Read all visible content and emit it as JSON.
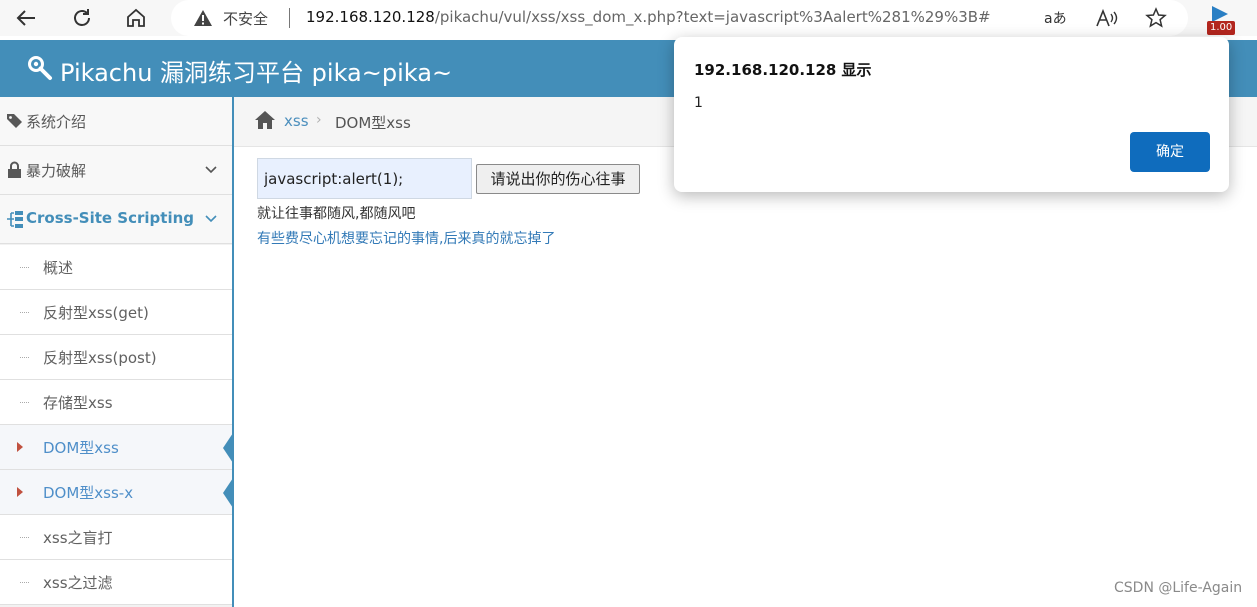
{
  "browser": {
    "security_label": "不安全",
    "url_host": "192.168.120.128",
    "url_path": "/pikachu/vul/xss/xss_dom_x.php?text=javascript%3Aalert%281%29%3B#",
    "extension_badge": "1.00"
  },
  "header": {
    "title": "Pikachu 漏洞练习平台 pika~pika~"
  },
  "sidebar": {
    "items": [
      {
        "label": "系统介绍",
        "icon": "tags-icon"
      },
      {
        "label": "暴力破解",
        "icon": "lock-icon"
      },
      {
        "label": "Cross-Site Scripting",
        "icon": "sitemap-icon"
      }
    ],
    "subitems": [
      {
        "label": "概述"
      },
      {
        "label": "反射型xss(get)"
      },
      {
        "label": "反射型xss(post)"
      },
      {
        "label": "存储型xss"
      },
      {
        "label": "DOM型xss"
      },
      {
        "label": "DOM型xss-x"
      },
      {
        "label": "xss之盲打"
      },
      {
        "label": "xss之过滤"
      }
    ]
  },
  "breadcrumb": {
    "link": "xss",
    "separator": "›",
    "current": "DOM型xss"
  },
  "form": {
    "input_value": "javascript:alert(1);",
    "button_label": "请说出你的伤心往事"
  },
  "content": {
    "line1": "就让往事都随风,都随风吧",
    "line2": "有些费尽心机想要忘记的事情,后来真的就忘掉了"
  },
  "dialog": {
    "title": "192.168.120.128 显示",
    "message": "1",
    "ok_label": "确定"
  },
  "watermark": "CSDN @Life-Again",
  "colors": {
    "header_bg": "#438eb9",
    "link": "#4c8fbd",
    "active_marker": "#c0513f",
    "dialog_button": "#0f6cbd"
  }
}
